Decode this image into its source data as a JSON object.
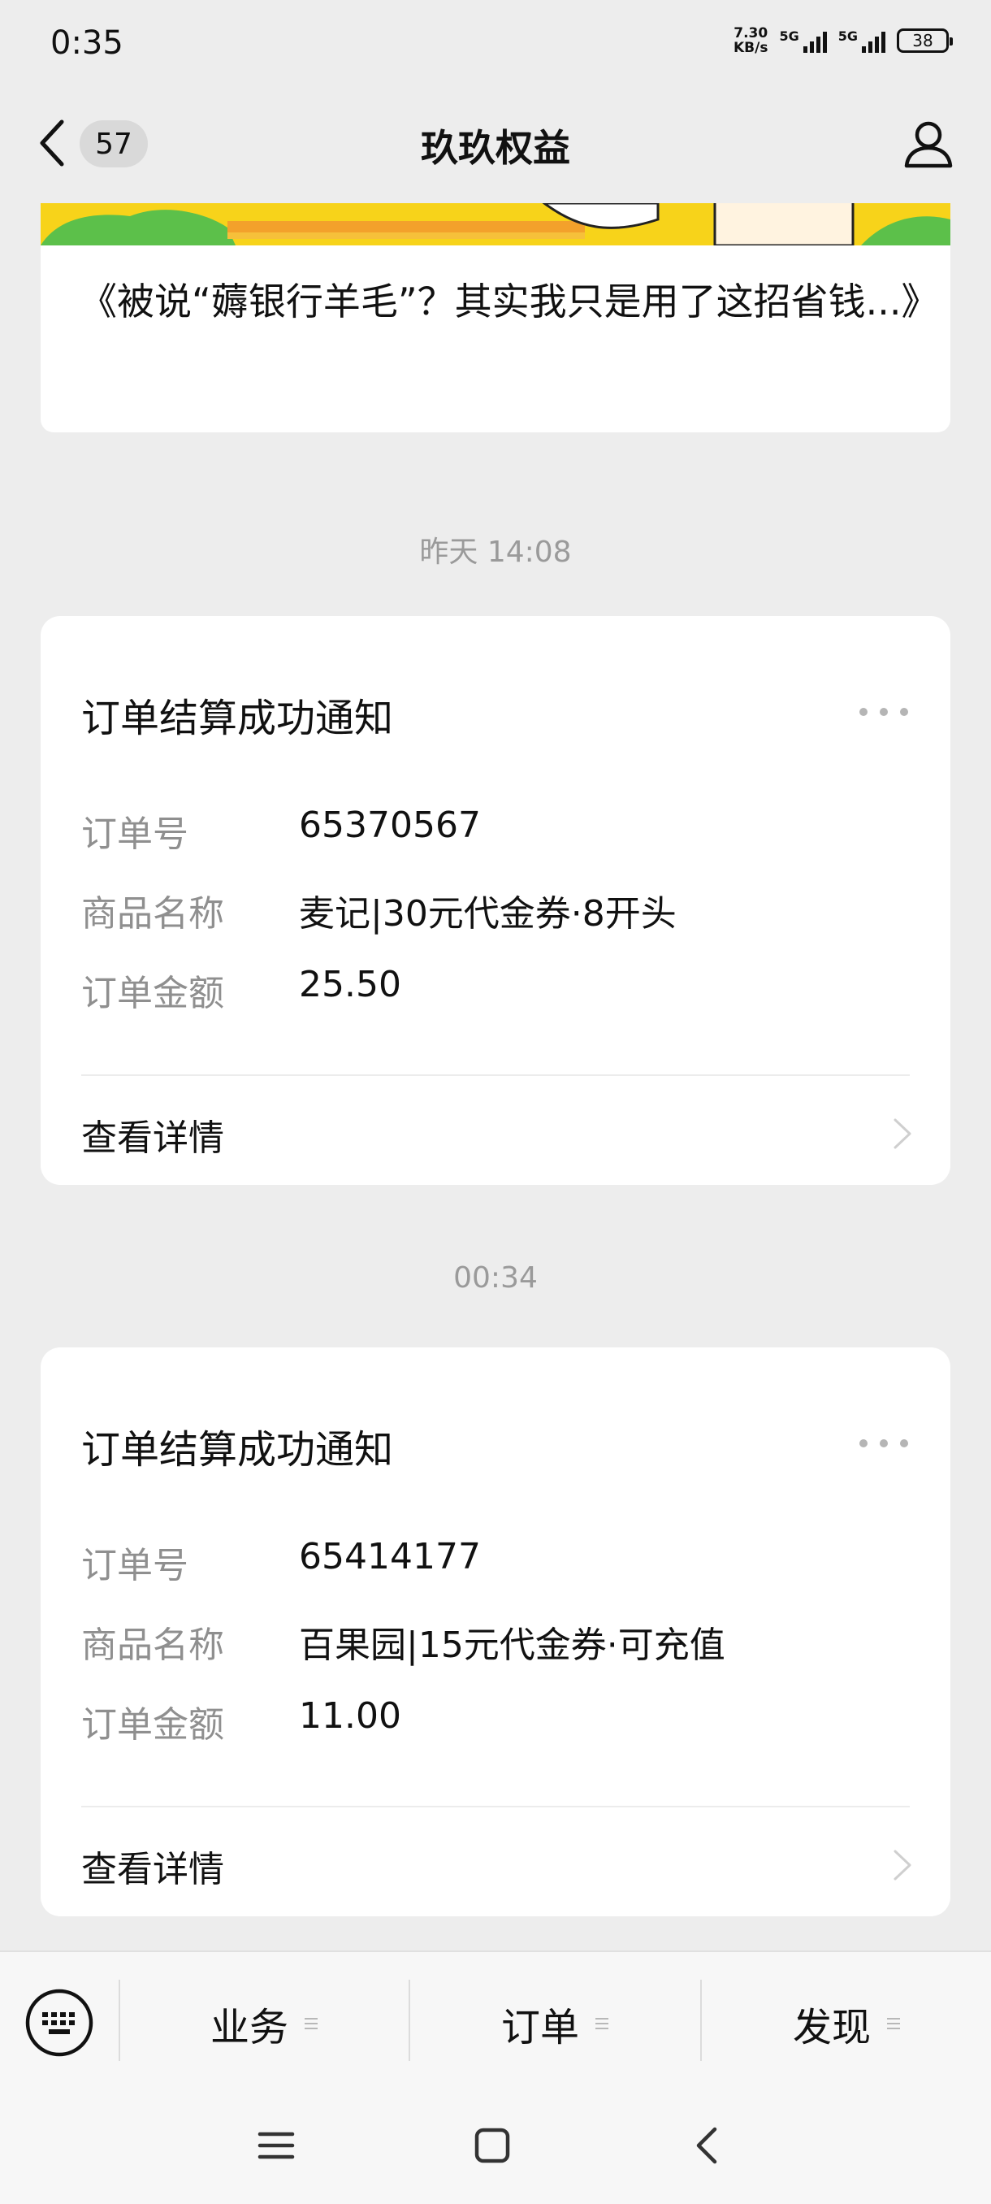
{
  "status_bar": {
    "time": "0:35",
    "net_speed_value": "7.30",
    "net_speed_unit": "KB/s",
    "signal1_label": "5G",
    "signal2_label": "5G",
    "battery": "38"
  },
  "header": {
    "back_badge": "57",
    "title": "玖玖权益"
  },
  "article": {
    "title": "《被说“薅银行羊毛”？其实我只是用了这招省钱...》"
  },
  "messages": [
    {
      "time": "昨天 14:08",
      "card_title": "订单结算成功通知",
      "rows": [
        {
          "label": "订单号",
          "value": "65370567"
        },
        {
          "label": "商品名称",
          "value": "麦记|30元代金券·8开头"
        },
        {
          "label": "订单金额",
          "value": "25.50"
        }
      ],
      "detail_label": "查看详情"
    },
    {
      "time": "00:34",
      "card_title": "订单结算成功通知",
      "rows": [
        {
          "label": "订单号",
          "value": "65414177"
        },
        {
          "label": "商品名称",
          "value": "百果园|15元代金券·可充值"
        },
        {
          "label": "订单金额",
          "value": "11.00"
        }
      ],
      "detail_label": "查看详情"
    }
  ],
  "bottom_menu": {
    "items": [
      {
        "label": "业务"
      },
      {
        "label": "订单"
      },
      {
        "label": "发现"
      }
    ]
  },
  "icons": {
    "back": "chevron-left-icon",
    "profile": "person-icon",
    "more": "more-dots-icon",
    "detail": "chevron-right-icon",
    "keyboard": "keyboard-icon",
    "menu": "menu-lines-icon"
  },
  "colors": {
    "background": "#ededed",
    "card": "#ffffff",
    "muted_text": "#8f8f8f",
    "time_label": "#9a9a9a"
  }
}
